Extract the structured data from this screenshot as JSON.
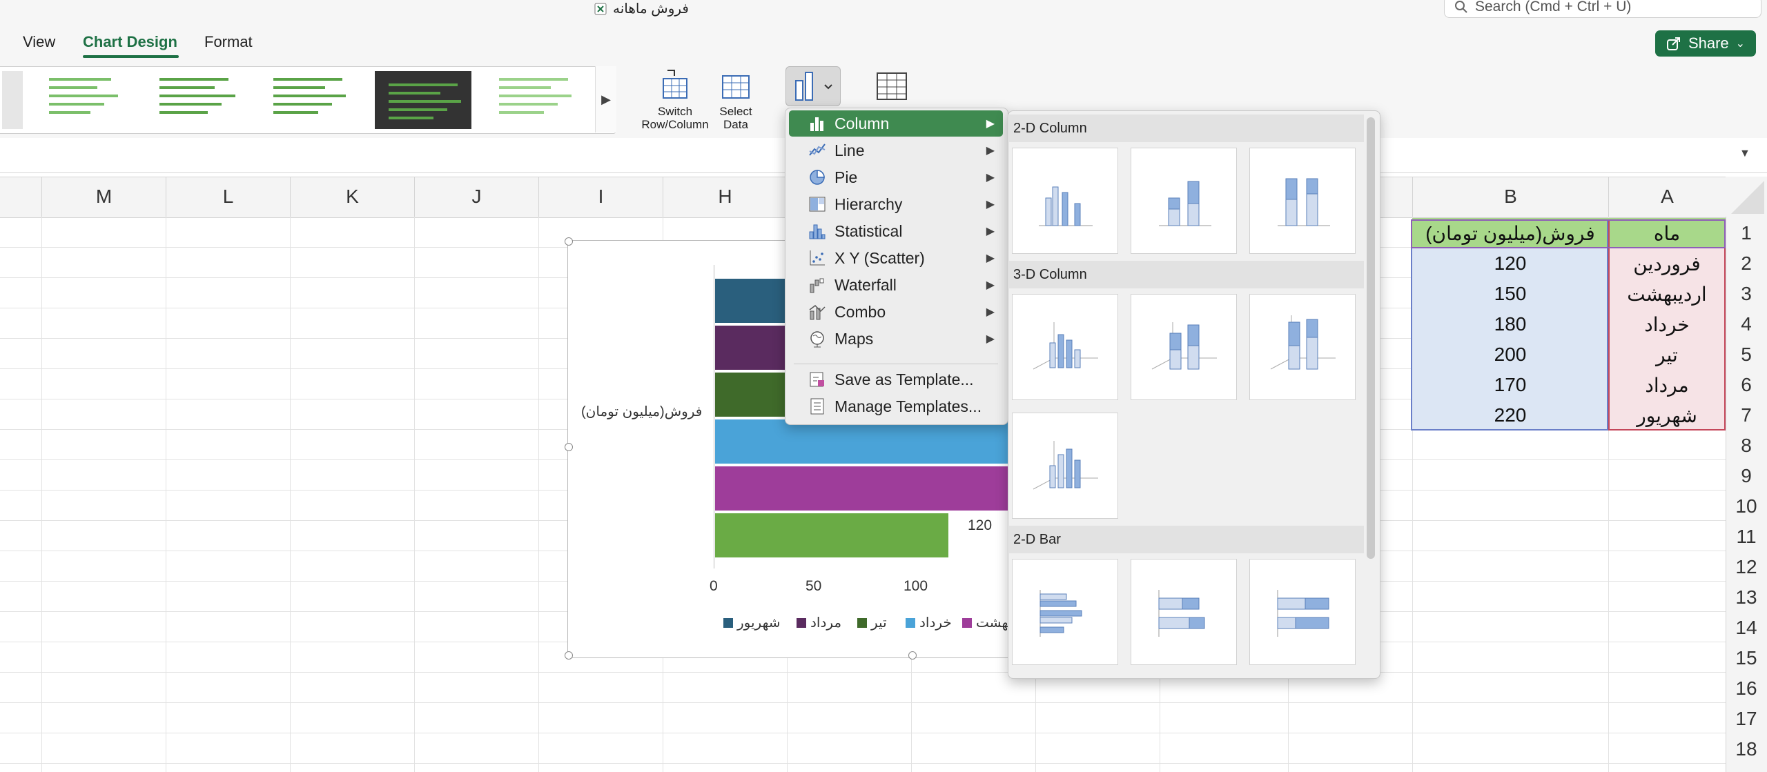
{
  "window": {
    "doc_title": "فروش ماهانه",
    "search_placeholder": "Search (Cmd + Ctrl + U)",
    "share_label": "Share"
  },
  "ribbon": {
    "tabs": [
      {
        "label": "View"
      },
      {
        "label": "Chart Design"
      },
      {
        "label": "Format"
      }
    ],
    "switch_row_column": "Switch\nRow/Column",
    "select_data": "Select\nData"
  },
  "columns": [
    "M",
    "L",
    "K",
    "J",
    "I",
    "H",
    "B",
    "A"
  ],
  "rows": [
    "1",
    "2",
    "3",
    "4",
    "5",
    "6",
    "7",
    "8",
    "9",
    "10",
    "11",
    "12",
    "13",
    "14",
    "15",
    "16",
    "17",
    "18"
  ],
  "table": {
    "header_b": "فروش(میلیون تومان)",
    "header_a": "ماه",
    "records": [
      {
        "month": "فروردین",
        "sales": "120"
      },
      {
        "month": "اردیبهشت",
        "sales": "150"
      },
      {
        "month": "خرداد",
        "sales": "180"
      },
      {
        "month": "تیر",
        "sales": "200"
      },
      {
        "month": "مرداد",
        "sales": "170"
      },
      {
        "month": "شهریور",
        "sales": "220"
      }
    ]
  },
  "chart_data": {
    "type": "bar",
    "ylabel": "فروش(میلیون تومان)",
    "x_ticks": [
      "0",
      "50",
      "100"
    ],
    "value_label": "120",
    "legend": [
      {
        "name": "شهریور",
        "color": "#2a5f7d"
      },
      {
        "name": "مرداد",
        "color": "#5a2b5f"
      },
      {
        "name": "تیر",
        "color": "#3f6a2a"
      },
      {
        "name": "خرداد",
        "color": "#4aa3d8"
      },
      {
        "name": "بهشت",
        "color": "#9e3d9a"
      }
    ],
    "bars": [
      {
        "color": "#2a5f7d"
      },
      {
        "color": "#5a2b5f"
      },
      {
        "color": "#3f6a2a"
      },
      {
        "color": "#4aa3d8"
      },
      {
        "color": "#9e3d9a"
      },
      {
        "color": "#6aab45",
        "value": 120
      }
    ]
  },
  "chart_menu": {
    "items": [
      {
        "label": "Column",
        "icon": "column-chart-icon",
        "submenu": true,
        "active": true
      },
      {
        "label": "Line",
        "icon": "line-chart-icon",
        "submenu": true
      },
      {
        "label": "Pie",
        "icon": "pie-chart-icon",
        "submenu": true
      },
      {
        "label": "Hierarchy",
        "icon": "hierarchy-chart-icon",
        "submenu": true
      },
      {
        "label": "Statistical",
        "icon": "statistical-chart-icon",
        "submenu": true
      },
      {
        "label": "X Y (Scatter)",
        "icon": "scatter-chart-icon",
        "submenu": true
      },
      {
        "label": "Waterfall",
        "icon": "waterfall-chart-icon",
        "submenu": true
      },
      {
        "label": "Combo",
        "icon": "combo-chart-icon",
        "submenu": true
      },
      {
        "label": "Maps",
        "icon": "maps-icon",
        "submenu": true
      }
    ],
    "save_template": "Save as Template...",
    "manage_templates": "Manage Templates..."
  },
  "submenu": {
    "sections": [
      {
        "title": "2-D Column"
      },
      {
        "title": "3-D Column"
      },
      {
        "title": "2-D Bar"
      }
    ]
  },
  "colors": {
    "accent": "#1e7145",
    "menu_highlight": "#3f8a50"
  }
}
